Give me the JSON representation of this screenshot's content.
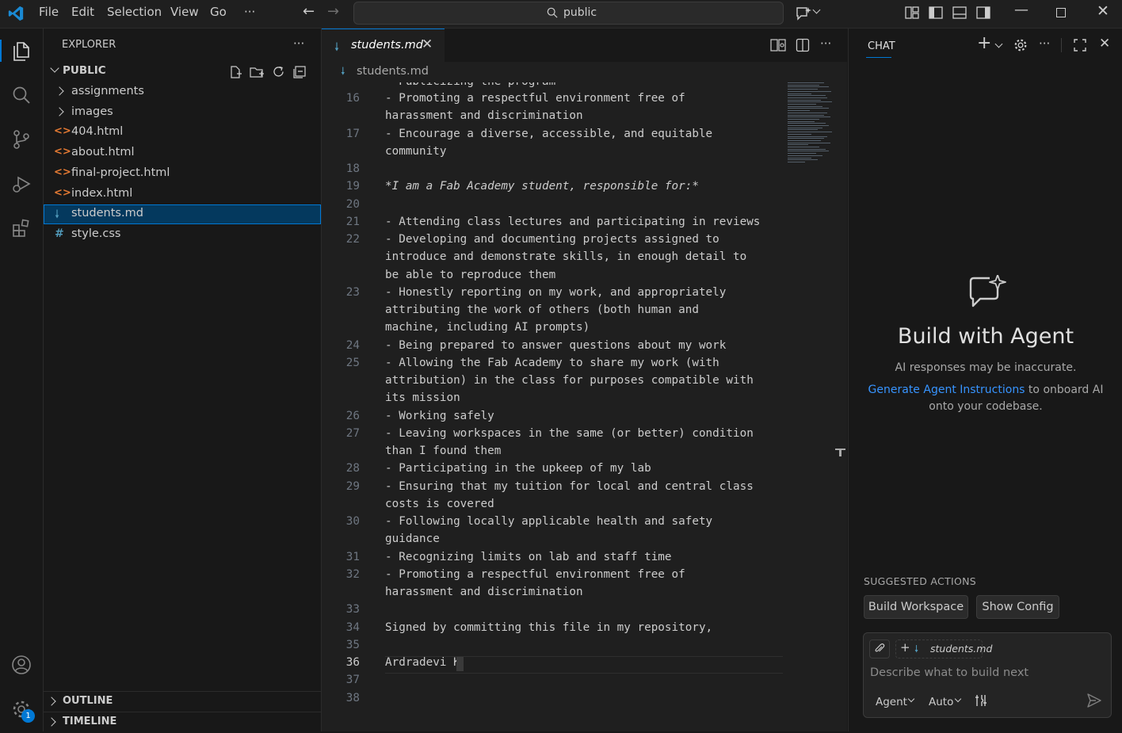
{
  "titlebar": {
    "menu": [
      "File",
      "Edit",
      "Selection",
      "View",
      "Go",
      "···"
    ],
    "search_text": "public"
  },
  "sidebar": {
    "title": "EXPLORER",
    "more": "···",
    "folder": "PUBLIC",
    "items": [
      {
        "label": "assignments",
        "type": "folder"
      },
      {
        "label": "images",
        "type": "folder"
      },
      {
        "label": "404.html",
        "type": "html"
      },
      {
        "label": "about.html",
        "type": "html"
      },
      {
        "label": "final-project.html",
        "type": "html"
      },
      {
        "label": "index.html",
        "type": "html"
      },
      {
        "label": "students.md",
        "type": "md"
      },
      {
        "label": "style.css",
        "type": "css"
      }
    ],
    "outline": "OUTLINE",
    "timeline": "TIMELINE"
  },
  "accounts_badge": "1",
  "editor": {
    "tab_label": "students.md",
    "breadcrumb": "students.md",
    "partial_top": "- Publicizing the program",
    "lines": [
      {
        "n": "16",
        "rows": [
          "- Promoting a respectful environment free of",
          "harassment and discrimination"
        ]
      },
      {
        "n": "17",
        "rows": [
          "- Encourage a diverse, accessible, and equitable",
          "community"
        ]
      },
      {
        "n": "18",
        "rows": [
          ""
        ]
      },
      {
        "n": "19",
        "rows": [
          "*I am a Fab Academy student, responsible for:*"
        ]
      },
      {
        "n": "20",
        "rows": [
          ""
        ]
      },
      {
        "n": "21",
        "rows": [
          "- Attending class lectures and participating in reviews"
        ]
      },
      {
        "n": "22",
        "rows": [
          "- Developing and documenting projects assigned to",
          "introduce and demonstrate skills, in enough detail to",
          "be able to reproduce them"
        ]
      },
      {
        "n": "23",
        "rows": [
          "- Honestly reporting on my work, and appropriately",
          "attributing the work of others (both human and",
          "machine, including AI prompts)"
        ]
      },
      {
        "n": "24",
        "rows": [
          "- Being prepared to answer questions about my work"
        ]
      },
      {
        "n": "25",
        "rows": [
          "- Allowing the Fab Academy to share my work (with",
          "attribution) in the class for purposes compatible with",
          "its mission"
        ]
      },
      {
        "n": "26",
        "rows": [
          "- Working safely"
        ]
      },
      {
        "n": "27",
        "rows": [
          "- Leaving workspaces in the same (or better) condition",
          "than I found them"
        ]
      },
      {
        "n": "28",
        "rows": [
          "- Participating in the upkeep of my lab"
        ]
      },
      {
        "n": "29",
        "rows": [
          "- Ensuring that my tuition for local and central class",
          "costs is covered"
        ]
      },
      {
        "n": "30",
        "rows": [
          "- Following locally applicable health and safety",
          "guidance"
        ]
      },
      {
        "n": "31",
        "rows": [
          "- Recognizing limits on lab and staff time"
        ]
      },
      {
        "n": "32",
        "rows": [
          "- Promoting a respectful environment free of",
          "harassment and discrimination"
        ]
      },
      {
        "n": "33",
        "rows": [
          ""
        ]
      },
      {
        "n": "34",
        "rows": [
          "Signed by committing this file in my repository,"
        ]
      },
      {
        "n": "35",
        "rows": [
          ""
        ]
      },
      {
        "n": "36",
        "rows": [
          "Ardradevi K"
        ]
      },
      {
        "n": "37",
        "rows": [
          ""
        ]
      },
      {
        "n": "38",
        "rows": [
          ""
        ]
      }
    ],
    "current_line": "36"
  },
  "chat": {
    "title": "CHAT",
    "more": "···",
    "heading": "Build with Agent",
    "disclaimer": "AI responses may be inaccurate.",
    "link_text": "Generate Agent Instructions",
    "link_rest_1": " to onboard AI",
    "link_rest_2": "onto your codebase.",
    "suggested_title": "SUGGESTED ACTIONS",
    "actions": [
      "Build Workspace",
      "Show Config"
    ],
    "context_file": "students.md",
    "input_placeholder": "Describe what to build next",
    "mode": "Agent",
    "model": "Auto"
  },
  "colors": {
    "accent": "#0078d4",
    "link": "#3794ff",
    "html_icon": "#e37933",
    "md_icon": "#519aba",
    "css_icon": "#519aba"
  }
}
